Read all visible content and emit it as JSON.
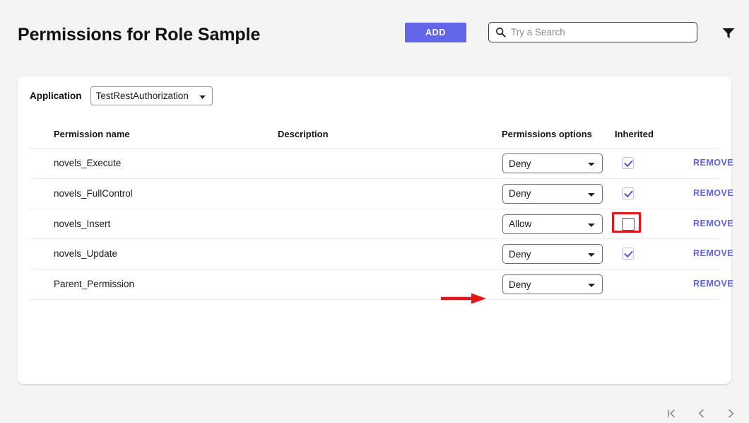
{
  "header": {
    "title": "Permissions for Role Sample",
    "add_label": "ADD",
    "search_placeholder": "Try a Search",
    "search_value": "",
    "filter_icon": "filter-funnel-icon",
    "search_icon": "search-icon",
    "accent_color": "#6366e8",
    "link_color": "#6064d6",
    "annotation_color": "#e01818"
  },
  "application": {
    "label": "Application",
    "selected": "TestRestAuthorization",
    "options": [
      "TestRestAuthorization"
    ]
  },
  "table": {
    "columns": {
      "name": "Permission name",
      "description": "Description",
      "options": "Permissions options",
      "inherited": "Inherited"
    },
    "remove_label": "REMOVE",
    "permission_options": [
      "Allow",
      "Deny"
    ],
    "rows": [
      {
        "name": "novels_Execute",
        "description": "",
        "permission": "Deny",
        "inherited": true,
        "has_checkbox": true,
        "highlighted": false,
        "remove": "REMOVE"
      },
      {
        "name": "novels_FullControl",
        "description": "",
        "permission": "Deny",
        "inherited": true,
        "has_checkbox": true,
        "highlighted": false,
        "remove": "REMOVE"
      },
      {
        "name": "novels_Insert",
        "description": "",
        "permission": "Allow",
        "inherited": false,
        "has_checkbox": true,
        "highlighted": true,
        "remove": "REMOVE"
      },
      {
        "name": "novels_Update",
        "description": "",
        "permission": "Deny",
        "inherited": true,
        "has_checkbox": true,
        "highlighted": false,
        "remove": "REMOVE"
      },
      {
        "name": "Parent_Permission",
        "description": "",
        "permission": "Deny",
        "inherited": false,
        "has_checkbox": false,
        "highlighted": false,
        "remove": "REMOVE"
      }
    ]
  },
  "pagination": {
    "first_label": "|<",
    "prev_label": "<",
    "next_label": ">"
  },
  "annotation": {
    "arrow_target": "novels_Insert inherited checkbox",
    "arrow_icon": "red-arrow-icon"
  }
}
